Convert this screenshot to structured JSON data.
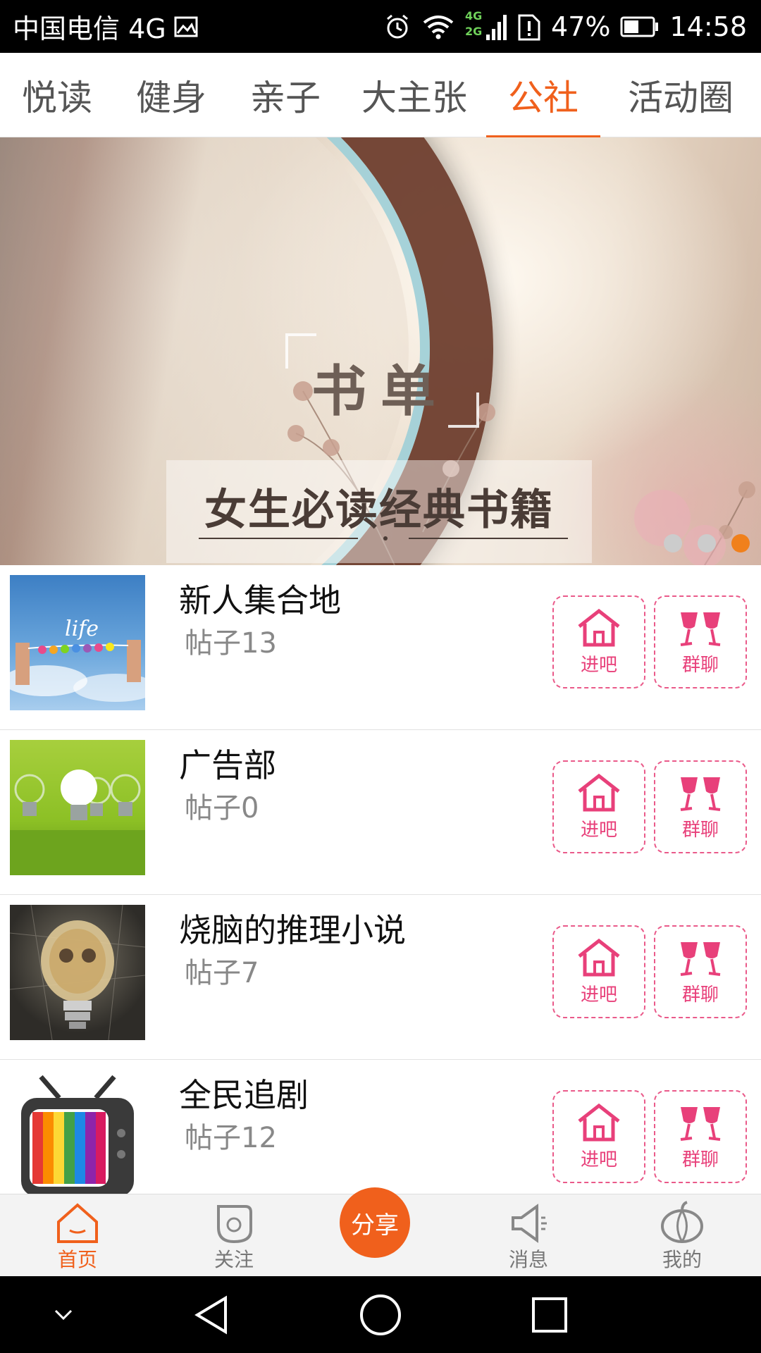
{
  "status_bar": {
    "carrier": "中国电信 4G",
    "network_top": "4G",
    "network_bottom": "2G",
    "battery": "47%",
    "time": "14:58"
  },
  "tabs": [
    {
      "label": "悦读",
      "active": false
    },
    {
      "label": "健身",
      "active": false
    },
    {
      "label": "亲子",
      "active": false
    },
    {
      "label": "大主张",
      "active": false
    },
    {
      "label": "公社",
      "active": true
    },
    {
      "label": "活动圈",
      "active": false
    }
  ],
  "banner": {
    "title": "书单",
    "subtitle": "女生必读经典书籍",
    "dots_total": 3,
    "active_dot": 3
  },
  "groups": [
    {
      "name": "新人集合地",
      "posts": "帖子13",
      "thumb": "hands-life-hearts"
    },
    {
      "name": "广告部",
      "posts": "帖子0",
      "thumb": "light-bulbs-green"
    },
    {
      "name": "烧脑的推理小说",
      "posts": "帖子7",
      "thumb": "glowing-bulb-owl"
    },
    {
      "name": "全民追剧",
      "posts": "帖子12",
      "thumb": "rainbow-tv"
    }
  ],
  "actions": {
    "enter_label": "进吧",
    "chat_label": "群聊"
  },
  "bottom_nav": {
    "home": "首页",
    "follow": "关注",
    "share": "分享",
    "messages": "消息",
    "mine": "我的"
  },
  "colors": {
    "accent": "#f0601c",
    "action_pink": "#e8407a"
  }
}
